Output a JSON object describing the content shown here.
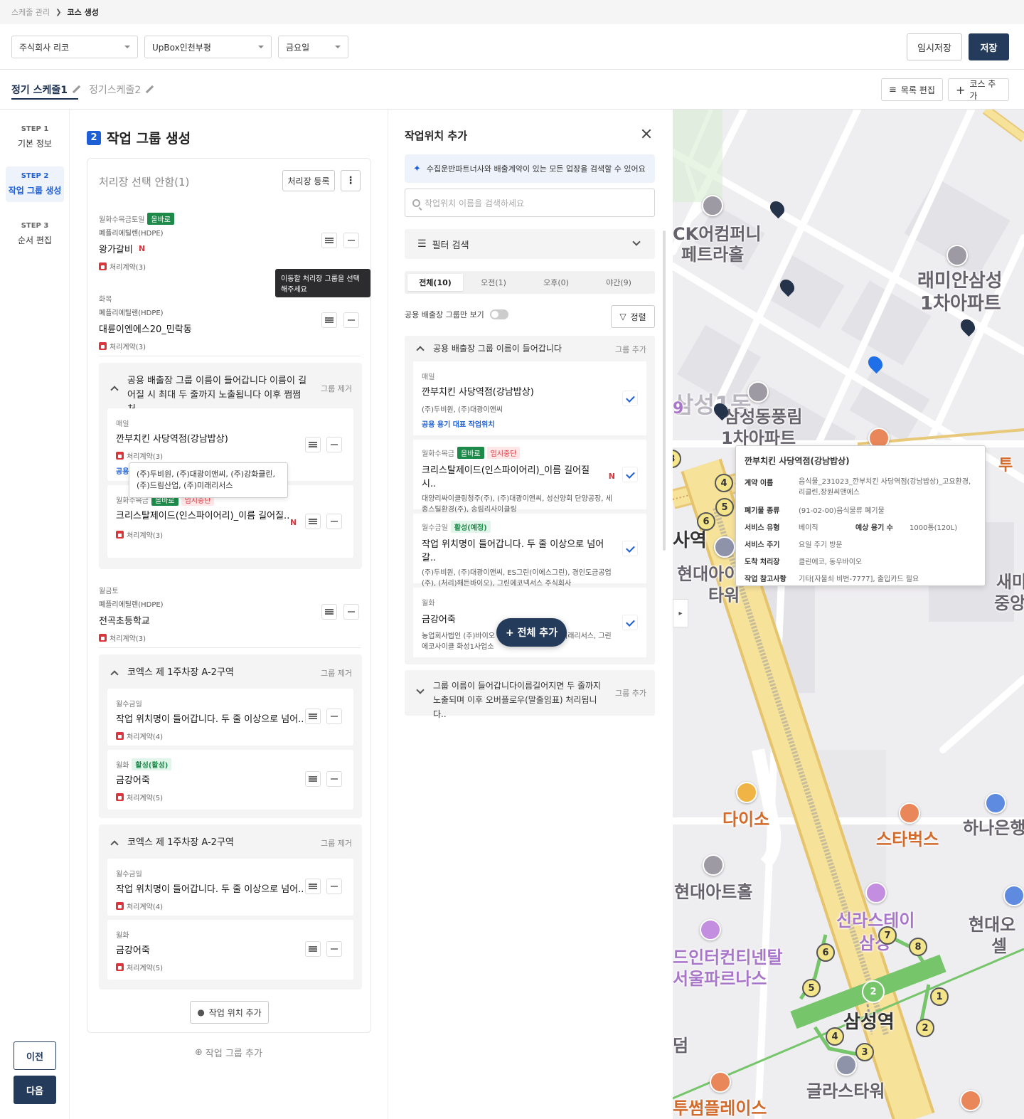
{
  "breadcrumb": {
    "parent": "스케줄 관리",
    "current": "코스 생성"
  },
  "top": {
    "company": "주식회사 리코",
    "branch": "UpBox인천부평",
    "day": "금요일",
    "temp_save": "임시저장",
    "save": "저장"
  },
  "tabs": [
    {
      "label": "정기 스케줄1"
    },
    {
      "label": "정기스케줄2"
    }
  ],
  "toolbar": {
    "edit_list": "목록 편집",
    "add_course": "코스 추가"
  },
  "steps": [
    {
      "num": "STEP 1",
      "label": "기본 정보"
    },
    {
      "num": "STEP 2",
      "label": "작업 그룹 생성"
    },
    {
      "num": "STEP 3",
      "label": "순서 편집"
    }
  ],
  "nav": {
    "prev": "이전",
    "next": "다음"
  },
  "section": {
    "num": "2",
    "title": "작업 그룹 생성"
  },
  "card": {
    "title": "처리장 선택 안함(1)",
    "register": "처리장 등록",
    "add_location": "작업 위치 추가",
    "add_group": "작업 그룹 추가"
  },
  "tooltip_move": "이동할 처리장 그룹을 선택해주세요",
  "items": [
    {
      "days": "월화수목금토일",
      "badge": "올바로",
      "waste": "폐플리에틸렌(HDPE)",
      "name": "왕가갈비",
      "n": "N",
      "contract": "처리계약(3)"
    },
    {
      "days": "화목",
      "waste": "폐플리에틸렌(HDPE)",
      "name": "대륜이엔에스20_민락동",
      "contract": "처리계약(3)"
    },
    {
      "days": "월금토",
      "waste": "폐플리에틸렌(HDPE)",
      "name": "전곡초등학교",
      "contract": "처리계약(3)"
    }
  ],
  "group1": {
    "title": "공용 배출장 그룹 이름이 들어갑니다 이름이 길어질 시 최대 두 줄까지 노출됩니다 이후 쩜쩜처..",
    "remove": "그룹 제거",
    "a": {
      "days": "매일",
      "name": "깐부치킨 사당역점(강남밥상)",
      "contract": "처리계약(3)",
      "link": "공용"
    },
    "b": {
      "days": "월화수목금",
      "badge1": "올바로",
      "badge2": "임시중단",
      "name": "크리스탈제이드(인스파이어리)_이름 길어질..",
      "n": "N",
      "contract": "처리계약(3)"
    },
    "tip": "(주)두비원, (주)대광이앤씨, (주)강화클린, (주)드림산업, (주)미래리서스"
  },
  "group2": {
    "title": "코엑스 제 1주차장 A-2구역",
    "remove": "그룹 제거",
    "a": {
      "days": "월수금일",
      "name": "작업 위치명이 들어갑니다. 두 줄 이상으로 넘어..",
      "contract": "처리계약(4)"
    },
    "b": {
      "days": "월화",
      "badge": "활성(활성)",
      "name": "금강어죽",
      "contract": "처리계약(5)"
    }
  },
  "group3": {
    "title": "코엑스 제 1주차장 A-2구역",
    "remove": "그룹 제거",
    "a": {
      "days": "월수금일",
      "name": "작업 위치명이 들어갑니다. 두 줄 이상으로 넘어..",
      "contract": "처리계약(4)"
    },
    "b": {
      "days": "월화",
      "name": "금강어죽",
      "contract": "처리계약(5)"
    }
  },
  "panel": {
    "title": "작업위치 추가",
    "info": "수집운반파트너사와 배출계약이 있는 모든 업장을 검색할 수 있어요",
    "search_placeholder": "작업위치 이름을 검색하세요",
    "filter": "필터 검색",
    "segs": [
      "전체(10)",
      "오전(1)",
      "오후(0)",
      "야간(9)"
    ],
    "toggle_label": "공용 배출장 그룹만 보기",
    "sort": "정렬",
    "fab": "+ 전체 추가",
    "rgroup1": {
      "title": "공용 배출장 그룹 이름이 들어갑니다",
      "add": "그룹 추가"
    },
    "r1": {
      "days": "매일",
      "name": "깐부치킨 사당역점(강남밥상)",
      "partners": "(주)두비원, (주)대광이앤씨",
      "link": "공용 용기 대표 작업위치"
    },
    "r2": {
      "days": "월화수목금",
      "badge1": "올바로",
      "badge2": "임시중단",
      "name": "크리스탈제이드(인스파이어리)_이름 길어질시..",
      "n": "N",
      "partners": "대양리싸이클링청주(주), (주)대광이앤씨, 성신양회 단양공장, 세종스틸환경(주), 송림리사이클링"
    },
    "r3": {
      "days": "월수금일",
      "badge": "활성(예정)",
      "name": "작업 위치명이 들어갑니다. 두 줄 이상으로 넘어갈..",
      "partners": "(주)두비원, (주)대광이앤씨, ES그린(이에스그린), 경인도금공업(주), (처리)해든바이오), 그린에코넥서스 주식회사"
    },
    "r4": {
      "days": "월화",
      "name": "금강어죽",
      "partners_a": "농업회사법인 (주)바이오",
      "partners_b": "리래리서스, 그린",
      "partners_c": "에코사이클 화성1사업소"
    },
    "rgroup2": {
      "title": "그룹 이름이 들어갑니다이름길어지면 두 줄까지 노출되며 이후 오버플로우(말줄임표) 처리됩니다..",
      "add": "그룹 추가"
    }
  },
  "map": {
    "popup": {
      "title": "깐부치킨 사당역점(강남밥상)",
      "rows": [
        [
          "계약 이름",
          "음식물_231023_깐부치킨 사당역점(강남밥상)_고요환경,리클린,장원씨앤에스"
        ],
        [
          "폐기물 종류",
          "(91-02-00)음식물류 폐기물"
        ],
        [
          "서비스 유형",
          "베이직"
        ],
        [
          "서비스 주기",
          "요일 주기 방문"
        ],
        [
          "도착 처리장",
          "클린에코, 동우바이오"
        ],
        [
          "작업 참고사항",
          "기타[자물쇠 비번-7777], 출입카드 필요"
        ]
      ],
      "cap_k": "예상 용기 수",
      "cap_v": "1000통(120L)"
    },
    "labels": [
      "CK어컴퍼니",
      "페트라홀",
      "래미안삼성",
      "1차아파트",
      "삼성1동",
      "삼성동풍림",
      "1차아파트",
      "사역",
      "현대아이",
      "타워",
      "다이소",
      "스타벅스",
      "하나은행",
      "현대아트홀",
      "신라스테이",
      "삼성",
      "드인터컨티넨탈",
      "서울파르나스",
      "삼성역",
      "글라스타워",
      "투썸플레이스",
      "새마",
      "중앙",
      "현대오",
      "셀",
      "투",
      "덤",
      "9"
    ],
    "stations": [
      "4",
      "5",
      "6",
      "3",
      "7",
      "8",
      "2",
      "1",
      "2",
      "5",
      "6",
      "4",
      "3"
    ]
  }
}
